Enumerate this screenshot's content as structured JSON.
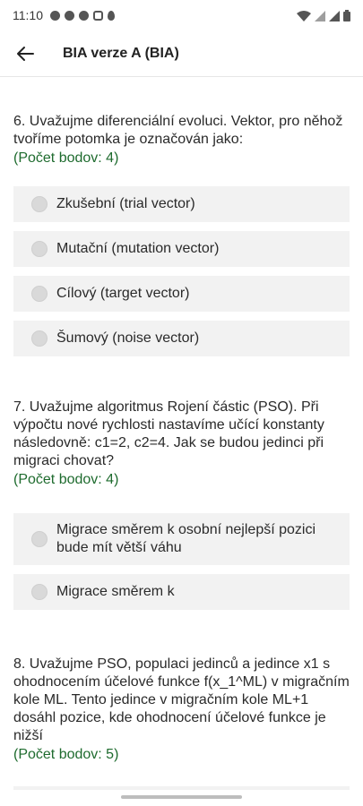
{
  "status_bar": {
    "time": "11:10"
  },
  "app_bar": {
    "title": "BIA verze A (BIA)"
  },
  "questions": [
    {
      "text": "6. Uvažujme diferenciální evoluci. Vektor, pro něhož tvoříme potomka je označován jako:",
      "points": "(Počet bodov: 4)",
      "options": [
        "Zkušební (trial vector)",
        "Mutační (mutation vector)",
        "Cílový (target vector)",
        "Šumový (noise vector)"
      ]
    },
    {
      "text": "7. Uvažujme algoritmus Rojení částic (PSO). Při výpočtu nové rychlosti nastavíme učící konstanty následovně: c1=2, c2=4. Jak se budou jedinci při migraci chovat?",
      "points": "(Počet bodov: 4)",
      "options": [
        "Migrace směrem k osobní nejlepší pozici bude mít větší váhu",
        "Migrace směrem k"
      ]
    },
    {
      "text": "8. Uvažujme PSO, populaci jedinců a jedince x1 s ohodnocením účelové funkce f(x_1^ML) v migračním kole ML. Tento jedince v migračním kole ML+1 dosáhl pozice, kde ohodnocení účelové funkce je nižší",
      "points": "(Počet bodov: 5)",
      "options": []
    }
  ]
}
